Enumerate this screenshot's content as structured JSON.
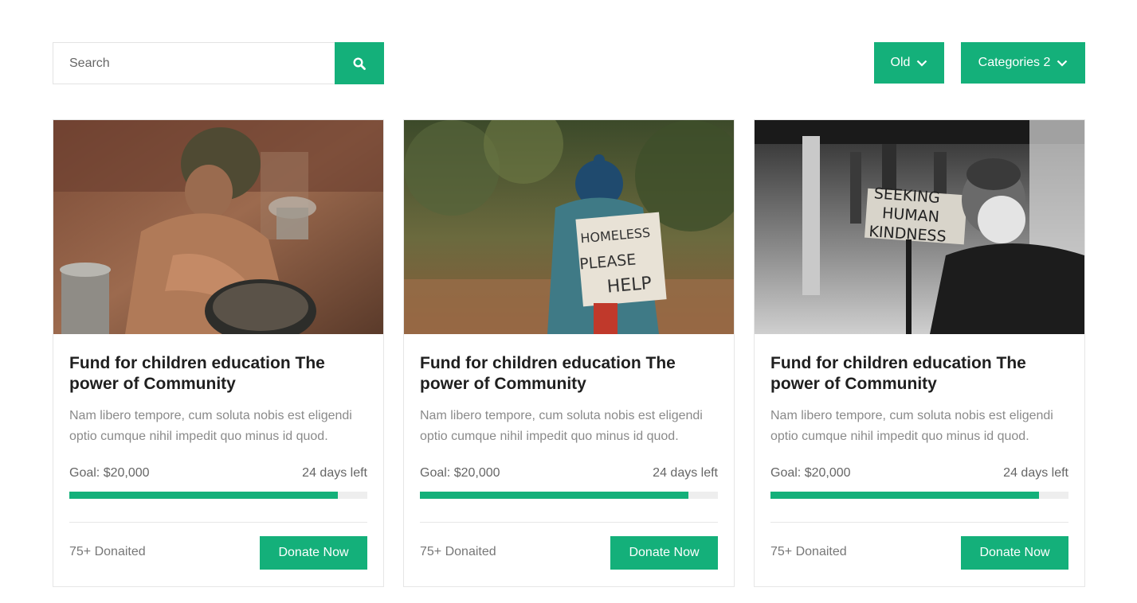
{
  "search": {
    "placeholder": "Search"
  },
  "filters": {
    "sort_label": "Old",
    "categories_label": "Categories 2"
  },
  "colors": {
    "accent": "#14b07a"
  },
  "cards": [
    {
      "image_subject": "child-with-pots",
      "title": "Fund for children education The power of Community",
      "description": "Nam libero tempore, cum soluta nobis est eligendi optio cumque nihil impedit quo minus id quod.",
      "goal": "Goal: $20,000",
      "days_left": "24 days left",
      "progress": 0.9,
      "donated": "75+ Donaited",
      "button": "Donate Now"
    },
    {
      "image_subject": "homeless-sign-help",
      "sign_text": [
        "HOMELESS",
        "PLEASE",
        "HELP"
      ],
      "title": "Fund for children education The power of Community",
      "description": "Nam libero tempore, cum soluta nobis est eligendi optio cumque nihil impedit quo minus id quod.",
      "goal": "Goal: $20,000",
      "days_left": "24 days left",
      "progress": 0.9,
      "donated": "75+ Donaited",
      "button": "Donate Now"
    },
    {
      "image_subject": "man-seeking-kindness",
      "sign_text": [
        "SEEKING",
        "HUMAN",
        "KINDNESS"
      ],
      "title": "Fund for children education The power of Community",
      "description": "Nam libero tempore, cum soluta nobis est eligendi optio cumque nihil impedit quo minus id quod.",
      "goal": "Goal: $20,000",
      "days_left": "24 days left",
      "progress": 0.9,
      "donated": "75+ Donaited",
      "button": "Donate Now"
    }
  ]
}
